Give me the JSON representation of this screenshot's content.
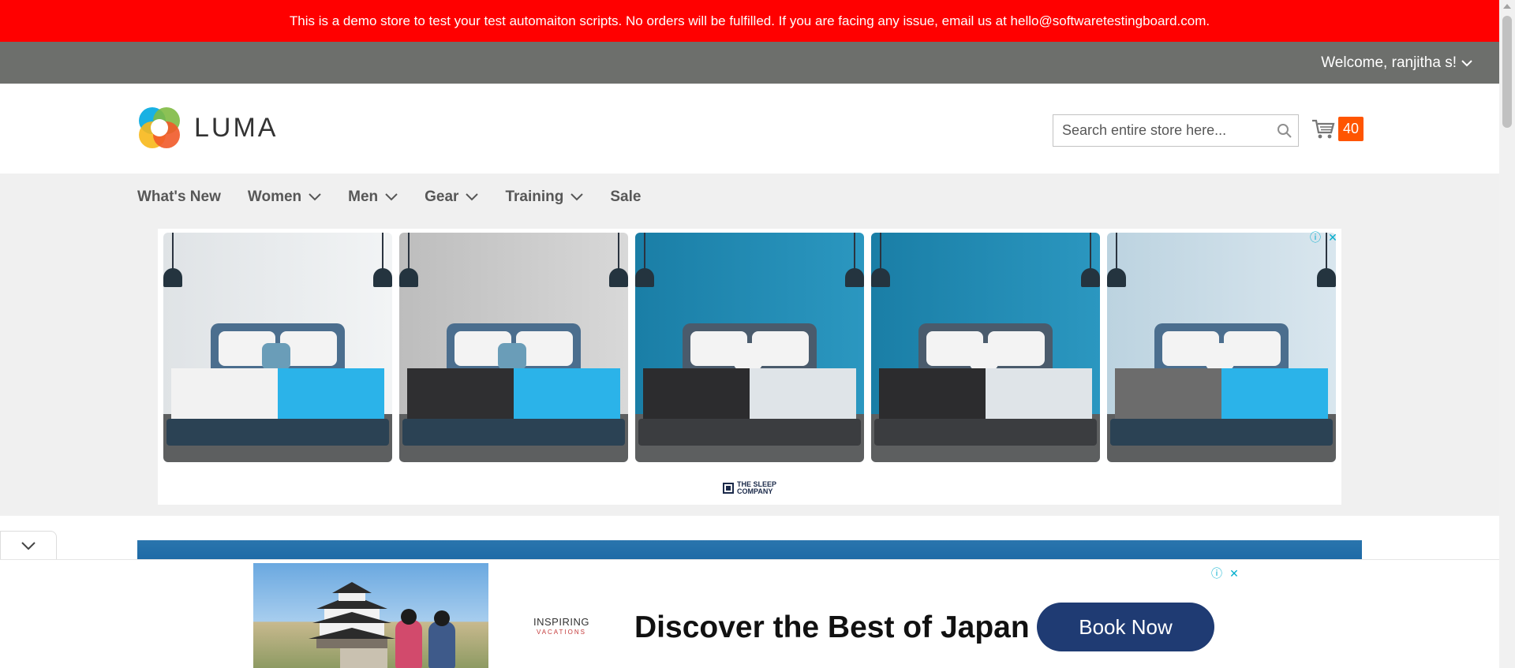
{
  "banner": {
    "text": "This is a demo store to test your test automaiton scripts. No orders will be fulfilled. If you are facing any issue, email us at hello@softwaretestingboard.com."
  },
  "header": {
    "welcome": "Welcome, ranjitha s!",
    "logo_text": "LUMA",
    "search_placeholder": "Search entire store here...",
    "cart_count": "40"
  },
  "nav": {
    "items": [
      {
        "label": "What's New",
        "has_dropdown": false
      },
      {
        "label": "Women",
        "has_dropdown": true
      },
      {
        "label": "Men",
        "has_dropdown": true
      },
      {
        "label": "Gear",
        "has_dropdown": true
      },
      {
        "label": "Training",
        "has_dropdown": true
      },
      {
        "label": "Sale",
        "has_dropdown": false
      }
    ]
  },
  "ad_top": {
    "brand": [
      "THE SLEEP",
      "COMPANY"
    ],
    "colors": {
      "wall_light": "#e8ebee",
      "wall_grey": "#c9c9c9",
      "wall_blue": "#1d86ad",
      "mattress_white": "#f2f2f2",
      "mattress_black": "#2f2f31",
      "mattress_grey": "#6c6c6c",
      "mattress_blue": "#2bb3e9"
    }
  },
  "ad_bottom": {
    "logo_main": "INSPIRING",
    "logo_sub": "VACATIONS",
    "headline": "Discover the Best of Japan",
    "cta": "Book Now"
  },
  "colors": {
    "banner_red": "#ff0000",
    "panel_grey": "#6d6f6c",
    "nav_bg": "#f0f0f0",
    "cart_badge": "#ff5501",
    "cta_navy": "#1f3b73"
  }
}
